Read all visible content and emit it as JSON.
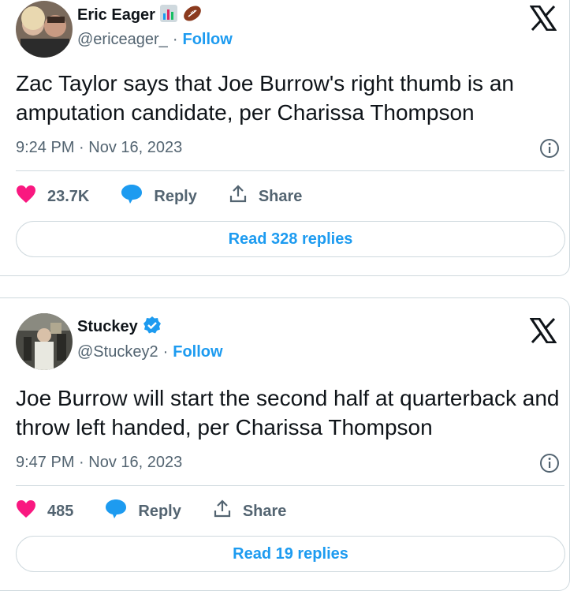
{
  "tweets": [
    {
      "author_name": "Eric Eager",
      "handle": "@ericeager_",
      "follow_label": "Follow",
      "text": "Zac Taylor says that Joe Burrow's right thumb is an amputation candidate, per Charissa Thompson",
      "timestamp": "9:24 PM · Nov 16, 2023",
      "likes": "23.7K",
      "reply_label": "Reply",
      "share_label": "Share",
      "read_replies_label": "Read 328 replies",
      "badges": [
        "bar-chart-emoji",
        "football-emoji"
      ]
    },
    {
      "author_name": "Stuckey",
      "handle": "@Stuckey2",
      "follow_label": "Follow",
      "text": "Joe Burrow will start the second half at quarterback and throw left handed, per Charissa Thompson",
      "timestamp": "9:47 PM · Nov 16, 2023",
      "likes": "485",
      "reply_label": "Reply",
      "share_label": "Share",
      "read_replies_label": "Read 19 replies",
      "badges": [
        "verified-badge"
      ]
    }
  ],
  "colors": {
    "accent": "#1d9bf0",
    "like": "#f91880",
    "secondary_text": "#536471",
    "border": "#cfd9de"
  },
  "dot_separator": "·"
}
